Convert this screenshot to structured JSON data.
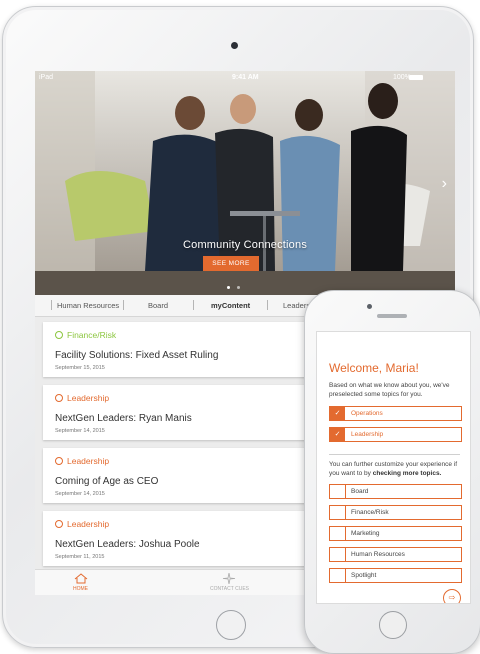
{
  "ipad": {
    "status": {
      "carrier": "iPad",
      "time": "9:41 AM",
      "battery": "100%"
    },
    "hero": {
      "title": "Community Connections",
      "cta": "SEE MORE"
    },
    "tabs": [
      "Human Resources",
      "Board",
      "myContent",
      "Leadership"
    ],
    "active_tab": "myContent",
    "cards": [
      {
        "category": "Finance/Risk",
        "category_color": "#8cc63f",
        "title": "Facility Solutions: Fixed Asset Ruling",
        "date": "September 15, 2015"
      },
      {
        "category": "Leadership",
        "category_color": "#e36a2f",
        "title": "NextGen Leaders: Ryan Manis",
        "date": "September 14, 2015"
      },
      {
        "category": "Leadership",
        "category_color": "#e36a2f",
        "title": "Coming of Age as CEO",
        "date": "September 14, 2015"
      },
      {
        "category": "Leadership",
        "category_color": "#e36a2f",
        "title": "NextGen Leaders: Joshua Poole",
        "date": "September 11, 2015"
      }
    ],
    "nav": {
      "home": "HOME",
      "contact": "CONTACT CUES"
    }
  },
  "iphone": {
    "welcome": "Welcome, Maria!",
    "intro": "Based on what we know about you, we've preselected some topics for you.",
    "selected_topics": [
      "Operations",
      "Leadership"
    ],
    "more_prefix": "You can further customize your experience if you want to by ",
    "more_bold": "checking more topics.",
    "more_topics": [
      "Board",
      "Finance/Risk",
      "Marketing",
      "Human Resources",
      "Spotlight"
    ]
  },
  "colors": {
    "accent": "#e36a2f",
    "finance": "#8cc63f"
  },
  "icons": {
    "hero_next": "chevron-right-icon",
    "home": "home-icon",
    "contact": "star-icon",
    "next": "arrow-right-icon",
    "check": "check-icon"
  }
}
